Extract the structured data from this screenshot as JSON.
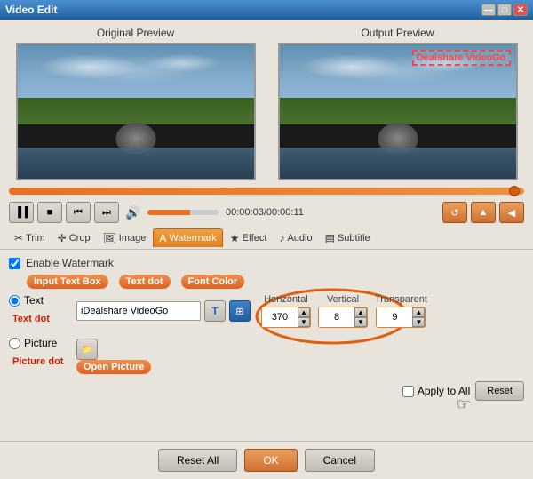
{
  "window": {
    "title": "Video Edit",
    "title_btn_min": "—",
    "title_btn_max": "□",
    "title_btn_close": "✕"
  },
  "previews": {
    "original_label": "Original Preview",
    "output_label": "Output Preview",
    "watermark": "Dealshare VideoGo"
  },
  "seek": {
    "time": "00:00:03/00:00:11"
  },
  "controls": {
    "play": "▐▐",
    "stop": "■",
    "prev": "⏮",
    "next": "⏭",
    "volume": "🔊",
    "back": "↺",
    "up": "▲",
    "left": "◀"
  },
  "tabs": [
    {
      "id": "trim",
      "label": "Trim",
      "icon": "✂"
    },
    {
      "id": "crop",
      "label": "Crop",
      "icon": "✛"
    },
    {
      "id": "image",
      "label": "Image",
      "icon": "🖼"
    },
    {
      "id": "watermark",
      "label": "Watermark",
      "icon": "A",
      "active": true
    },
    {
      "id": "effect",
      "label": "Effect",
      "icon": "★"
    },
    {
      "id": "audio",
      "label": "Audio",
      "icon": "♪"
    },
    {
      "id": "subtitle",
      "label": "Subtitle",
      "icon": "▤"
    }
  ],
  "watermark": {
    "enable_label": "Enable Watermark",
    "input_textbox_label": "Input Text Box",
    "text_dot_label": "Text dot",
    "font_color_label": "Font Color",
    "text_label": "Text",
    "text_dot_side_label": "Text dot",
    "text_value": "iDealshare VideoGo",
    "picture_label": "Picture",
    "picture_dot_label": "Picture dot",
    "open_picture_label": "Open Picture",
    "horizontal_label": "Horizontal",
    "vertical_label": "Vertical",
    "transparent_label": "Transparent",
    "horizontal_value": "370",
    "vertical_value": "8",
    "transparent_value": "9",
    "apply_all_label": "Apply to All",
    "reset_label": "Reset",
    "reset_all_label": "Reset All",
    "ok_label": "OK",
    "cancel_label": "Cancel"
  }
}
